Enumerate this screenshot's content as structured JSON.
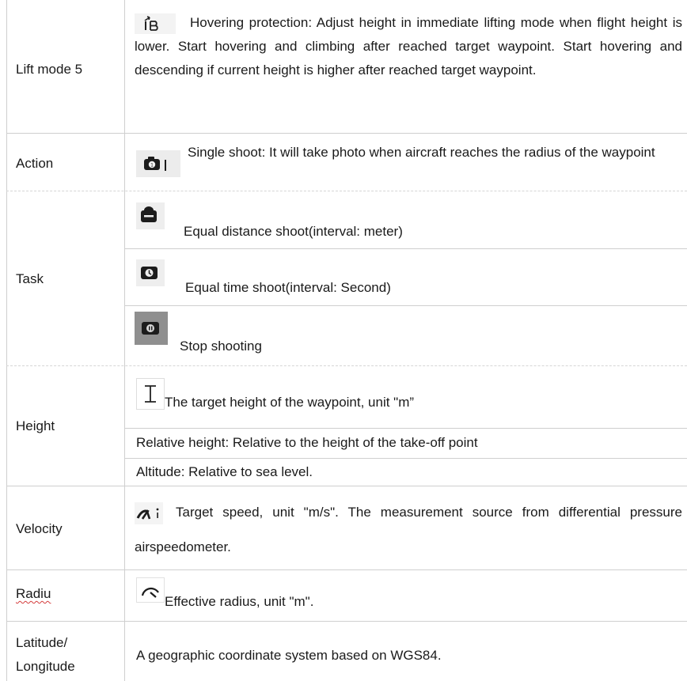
{
  "rows": {
    "lift_mode_5": {
      "label": "Lift mode 5",
      "icon": "lift-mode-icon",
      "text": "Hovering protection: Adjust height in immediate lifting mode when flight height is lower. Start hovering and climbing after reached target waypoint. Start hovering and descending if current height is higher after reached target waypoint."
    },
    "action": {
      "label": "Action",
      "icon": "single-shoot-camera-icon",
      "text": "Single shoot: It will take photo when aircraft reaches the radius of the waypoint"
    },
    "task": {
      "label": "Task",
      "items": [
        {
          "icon": "distance-camera-icon",
          "text": "Equal distance shoot(interval: meter)"
        },
        {
          "icon": "timer-camera-icon",
          "text": "Equal time shoot(interval: Second)"
        },
        {
          "icon": "stop-camera-icon",
          "text": "Stop shooting"
        }
      ]
    },
    "height": {
      "label": "Height",
      "icon": "height-cursor-icon",
      "text": "The target height of the waypoint, unit \"m”",
      "relative": "Relative height: Relative to the height of the take-off point",
      "altitude": "Altitude: Relative to sea level."
    },
    "velocity": {
      "label": "Velocity",
      "icon": "speed-gauge-icon",
      "text": "Target speed, unit \"m/s\". The measurement source from differential pressure airspeedometer."
    },
    "radiu": {
      "label": "Radiu",
      "icon": "radius-arc-icon",
      "text": "Effective radius, unit \"m\"."
    },
    "lat_long": {
      "label_line1": "Latitude/",
      "label_line2": "Longitude",
      "text": "A geographic coordinate system based on WGS84."
    }
  }
}
